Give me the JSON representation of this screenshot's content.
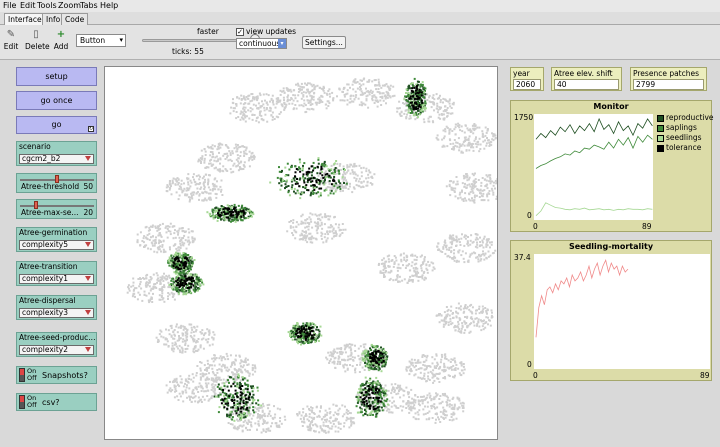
{
  "menu": [
    "File",
    "Edit",
    "Tools",
    "Zoom",
    "Tabs",
    "Help"
  ],
  "tabs": [
    "Interface",
    "Info",
    "Code"
  ],
  "toolbar": {
    "edit": "Edit",
    "delete": "Delete",
    "add": "Add",
    "widget_type": "Button",
    "speed_label": "faster",
    "ticks": "ticks: 55",
    "view_updates": "view updates",
    "view_updates_checked": true,
    "update_mode": "continuous",
    "settings": "Settings..."
  },
  "buttons": {
    "setup": "setup",
    "go_once": "go once",
    "go": "go"
  },
  "choosers": {
    "scenario": {
      "label": "scenario",
      "value": "cgcm2_b2"
    },
    "germination": {
      "label": "Atree-germination",
      "value": "complexity5"
    },
    "transition": {
      "label": "Atree-transition",
      "value": "complexity1"
    },
    "dispersal": {
      "label": "Atree-dispersal",
      "value": "complexity3"
    },
    "seed": {
      "label": "Atree-seed-produc...",
      "value": "complexity2"
    }
  },
  "sliders": {
    "threshold": {
      "label": "Atree-threshold",
      "value": "50",
      "fraction": 0.5
    },
    "max_seed": {
      "label": "Atree-max-se...",
      "value": "20",
      "fraction": 0.2
    }
  },
  "switches": {
    "snapshots": {
      "on": "On",
      "off": "Off",
      "label": "Snapshots?"
    },
    "csv": {
      "on": "On",
      "off": "Off",
      "label": "csv?"
    }
  },
  "monitors": {
    "year": {
      "label": "year",
      "value": "2060"
    },
    "elev_shift": {
      "label": "Atree elev. shift",
      "value": "40"
    },
    "presence": {
      "label": "Presence patches",
      "value": "2799"
    }
  },
  "colors": {
    "reproductive": "#1f4f22",
    "saplings": "#3f8a3a",
    "seedlings": "#a6d894",
    "tolerance": "#000000",
    "mortality": "#f08a8a",
    "terrain": "#cfcfcf"
  },
  "chart_data": [
    {
      "type": "line",
      "title": "Monitor",
      "xlim": [
        0,
        89
      ],
      "ylim": [
        0,
        1750
      ],
      "x_tick_labels": [
        "0",
        "89"
      ],
      "y_tick_labels": [
        "0",
        "1750"
      ],
      "legend": "right",
      "series": [
        {
          "name": "reproductive",
          "values": [
            1350,
            1450,
            1380,
            1500,
            1420,
            1560,
            1480,
            1600,
            1450,
            1580,
            1500,
            1620,
            1480,
            1700,
            1520,
            1600,
            1450,
            1650,
            1500,
            1580,
            1420,
            1620,
            1540,
            1700,
            1580
          ]
        },
        {
          "name": "saplings",
          "values": [
            850,
            900,
            930,
            980,
            1020,
            1050,
            1100,
            1080,
            1150,
            1120,
            1200,
            1180,
            1250,
            1220,
            1180,
            1300,
            1200,
            1350,
            1250,
            1380,
            1200,
            1400,
            1300,
            1420,
            1350
          ]
        },
        {
          "name": "seedlings",
          "values": [
            40,
            120,
            260,
            220,
            180,
            170,
            150,
            140,
            160,
            150,
            170,
            140,
            150,
            160,
            140,
            150,
            130,
            150,
            140,
            160,
            150,
            150,
            140,
            160,
            150
          ]
        },
        {
          "name": "tolerance",
          "values": []
        }
      ]
    },
    {
      "type": "line",
      "title": "Seedling-mortality",
      "xlim": [
        0,
        89
      ],
      "ylim": [
        0,
        37.4
      ],
      "x_tick_labels": [
        "0",
        "89"
      ],
      "y_tick_labels": [
        "0",
        "37.4"
      ],
      "series": [
        {
          "name": "",
          "values": [
            10,
            20,
            24,
            21,
            26,
            27,
            25,
            28,
            26,
            29,
            28,
            30,
            27,
            31,
            29,
            30,
            32,
            29,
            31,
            34,
            30,
            33,
            35,
            31,
            34,
            36,
            32,
            35,
            33,
            34,
            31,
            34,
            32,
            33
          ]
        }
      ]
    }
  ]
}
